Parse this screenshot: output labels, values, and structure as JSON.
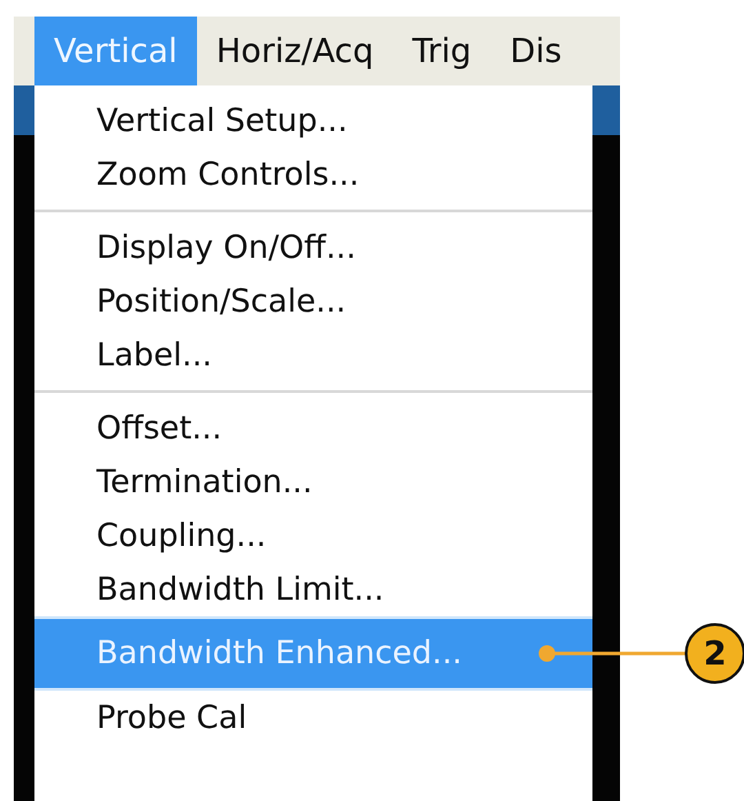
{
  "menu_bar": {
    "items": [
      {
        "label": "Vertical",
        "selected": true
      },
      {
        "label": "Horiz/Acq",
        "selected": false
      },
      {
        "label": "Trig",
        "selected": false
      },
      {
        "label": "Dis",
        "selected": false
      }
    ]
  },
  "menu": {
    "groups": [
      {
        "items": [
          {
            "label": "Vertical Setup...",
            "selected": false
          },
          {
            "label": "Zoom Controls...",
            "selected": false
          }
        ]
      },
      {
        "items": [
          {
            "label": "Display On/Off...",
            "selected": false
          },
          {
            "label": "Position/Scale...",
            "selected": false
          },
          {
            "label": "Label...",
            "selected": false
          }
        ]
      },
      {
        "items": [
          {
            "label": "Offset...",
            "selected": false
          },
          {
            "label": "Termination...",
            "selected": false
          },
          {
            "label": "Coupling...",
            "selected": false
          },
          {
            "label": "Bandwidth Limit...",
            "selected": false
          },
          {
            "label": "Bandwidth Enhanced...",
            "selected": true,
            "callout": "2"
          },
          {
            "label": "Probe Cal",
            "selected": false
          }
        ]
      }
    ]
  }
}
